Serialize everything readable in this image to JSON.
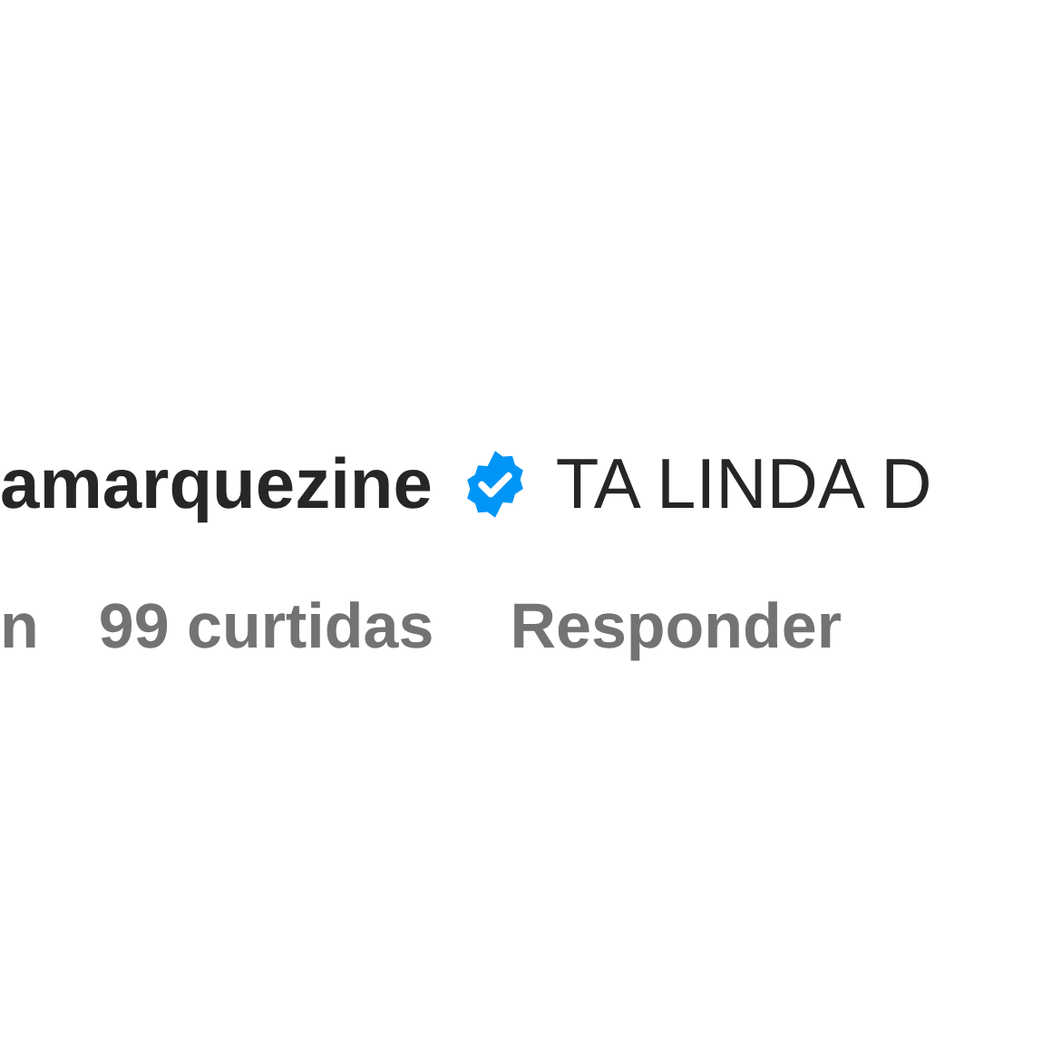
{
  "comment": {
    "username": "amarquezine",
    "verified": true,
    "text": "TA LINDA D"
  },
  "meta": {
    "time": "n",
    "likes": "99 curtidas",
    "reply": "Responder"
  }
}
